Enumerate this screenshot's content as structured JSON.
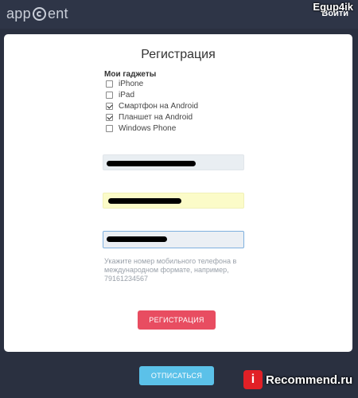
{
  "header": {
    "logo_text_left": "app",
    "logo_text_right": "ent",
    "login_label": "Войти",
    "watermark": "Egup4ik"
  },
  "form": {
    "title": "Регистрация",
    "gadgets_label": "Мои гаджеты",
    "gadgets": [
      {
        "label": "iPhone",
        "checked": false
      },
      {
        "label": "iPad",
        "checked": false
      },
      {
        "label": "Смартфон на Android",
        "checked": true
      },
      {
        "label": "Планшет на Android",
        "checked": true
      },
      {
        "label": "Windows Phone",
        "checked": false
      }
    ],
    "phone_hint": "Укажите номер мобильного телефона в международном формате, например, 79161234567",
    "submit_label": "РЕГИСТРАЦИЯ"
  },
  "footer": {
    "unsubscribe_label": "ОТПИСАТЬСЯ",
    "recommend_badge": "i",
    "recommend_text": "Recommend.ru"
  }
}
